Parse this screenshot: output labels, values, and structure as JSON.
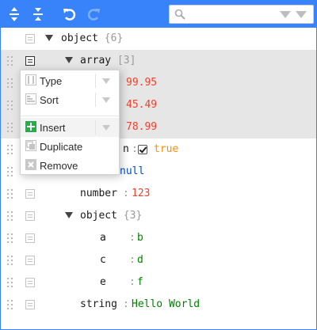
{
  "toolbar": {
    "expand_all_icon": "expand-all-icon",
    "collapse_all_icon": "collapse-all-icon",
    "undo_icon": "undo-icon",
    "redo_icon": "redo-icon",
    "search": {
      "value": "",
      "placeholder": ""
    }
  },
  "tree": {
    "root": {
      "field": "object",
      "count": "{6}"
    },
    "array": {
      "field": "array",
      "count": "[3]"
    },
    "array_values": [
      "99.95",
      "45.49",
      "78.99"
    ],
    "boolean": {
      "field_visible": "n",
      "sep": ":",
      "value": "true",
      "checked": true
    },
    "null_value": "null",
    "number": {
      "field": "number",
      "sep": ":",
      "value": "123"
    },
    "object": {
      "field": "object",
      "count": "{3}"
    },
    "object_items": [
      {
        "field": "a",
        "sep": ":",
        "value": "b"
      },
      {
        "field": "c",
        "sep": ":",
        "value": "d"
      },
      {
        "field": "e",
        "sep": ":",
        "value": "f"
      }
    ],
    "string": {
      "field": "string",
      "sep": ":",
      "value": "Hello World"
    }
  },
  "context_menu": {
    "items": [
      {
        "label": "Type",
        "icon": "type-icon",
        "submenu": true
      },
      {
        "label": "Sort",
        "icon": "sort-icon",
        "submenu": true
      },
      {
        "label": "Insert",
        "icon": "insert-icon",
        "submenu": true
      },
      {
        "label": "Duplicate",
        "icon": "duplicate-icon",
        "submenu": false
      },
      {
        "label": "Remove",
        "icon": "remove-icon",
        "submenu": false
      }
    ]
  },
  "colors": {
    "accent": "#3883fa",
    "number": "#ee422e",
    "string": "#008000",
    "boolean": "#ff8c00",
    "null": "#004ed0"
  }
}
